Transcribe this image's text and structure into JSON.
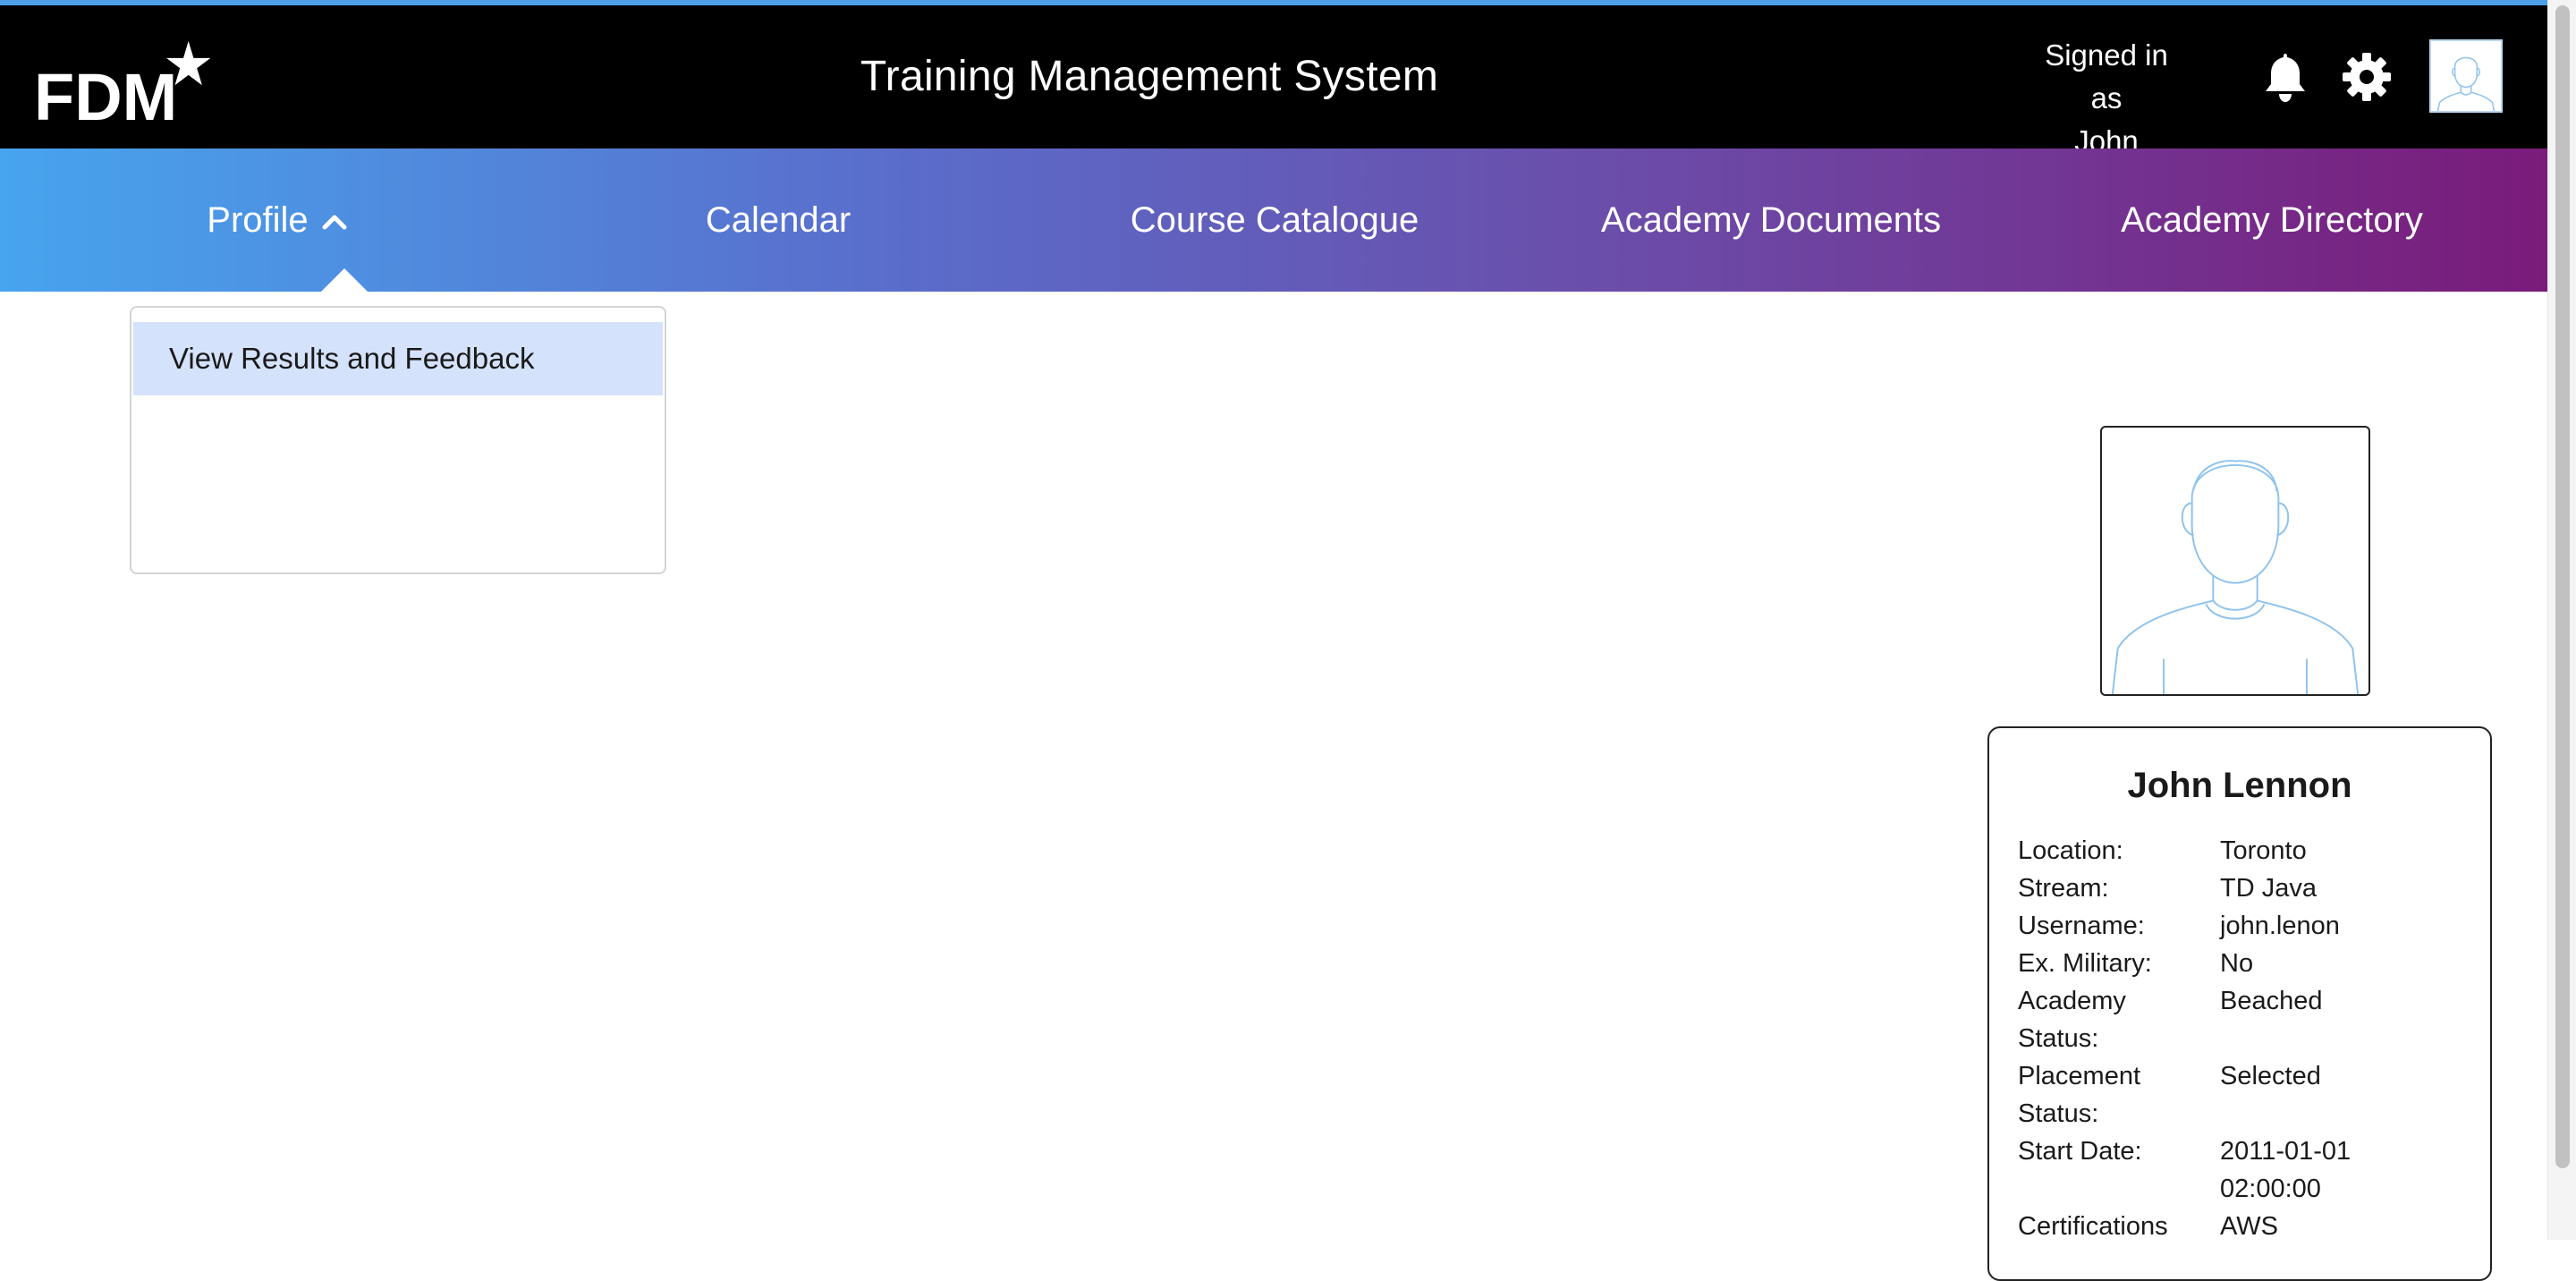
{
  "header": {
    "logo_text": "FDM",
    "title": "Training Management System",
    "signed_in_line1": "Signed in as",
    "signed_in_user": "John",
    "icons": [
      "bell-icon",
      "gear-icon",
      "avatar-icon"
    ]
  },
  "nav": {
    "items": [
      {
        "label": "Profile",
        "expanded": true
      },
      {
        "label": "Calendar"
      },
      {
        "label": "Course Catalogue"
      },
      {
        "label": "Academy Documents"
      },
      {
        "label": "Academy Directory"
      }
    ]
  },
  "dropdown": {
    "items": [
      "View Results and Feedback"
    ]
  },
  "profile": {
    "name": "John Lennon",
    "details": [
      {
        "label": "Location:",
        "value": "Toronto"
      },
      {
        "label": "Stream:",
        "value": "TD Java"
      },
      {
        "label": "Username:",
        "value": "john.lenon"
      },
      {
        "label": "Ex. Military:",
        "value": "No"
      },
      {
        "label": "Academy Status:",
        "value": "Beached"
      },
      {
        "label": "Placement Status:",
        "value": "Selected"
      },
      {
        "label": "Start Date:",
        "value": "2011-01-01 02:00:00"
      },
      {
        "label": "Certifications",
        "value": "AWS"
      }
    ]
  },
  "colors": {
    "header_bg": "#000000",
    "nav_gradient_start": "#47a4ee",
    "nav_gradient_end": "#7a1b7a",
    "dropdown_highlight": "#d5e2fb",
    "avatar_line": "#8fc3ee"
  }
}
